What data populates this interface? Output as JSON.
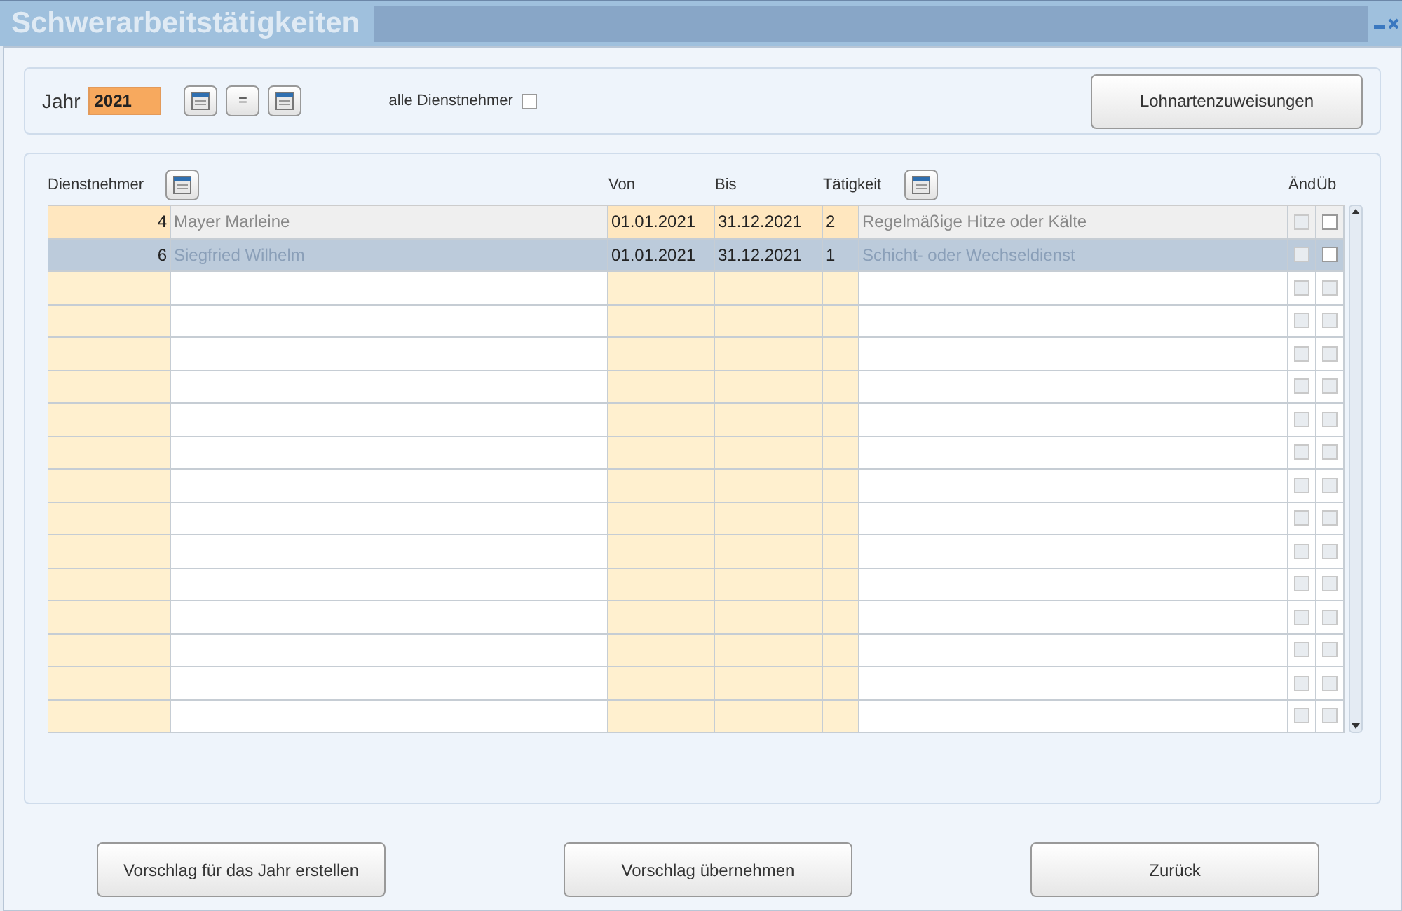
{
  "window": {
    "title": "Schwerarbeitstätigkeiten"
  },
  "filter": {
    "year_label": "Jahr",
    "year_value": "2021",
    "equals_button": "=",
    "all_label": "alle Dienstnehmer",
    "all_checked": false,
    "assign_button": "Lohnartenzuweisungen"
  },
  "table": {
    "columns": [
      {
        "label": "Dienstnehmer",
        "picker": true
      },
      {
        "label": "Von",
        "picker": false
      },
      {
        "label": "Bis",
        "picker": false
      },
      {
        "label": "Tätigkeit",
        "picker": true
      },
      {
        "label": "Änd",
        "picker": false
      },
      {
        "label": "Üb",
        "picker": false
      }
    ],
    "rows": [
      {
        "number": "4",
        "name": "Mayer Marleine",
        "from": "01.01.2021",
        "to": "31.12.2021",
        "code": "2",
        "activity": "Regelmäßige Hitze oder Kälte",
        "changed": false,
        "taken": false,
        "selected": false
      },
      {
        "number": "6",
        "name": "Siegfried Wilhelm",
        "from": "01.01.2021",
        "to": "31.12.2021",
        "code": "1",
        "activity": "Schicht- oder Wechseldienst",
        "changed": false,
        "taken": false,
        "selected": true
      },
      {
        "changed": false,
        "taken": false,
        "selected": false
      },
      {
        "changed": false,
        "taken": false,
        "selected": false
      },
      {
        "changed": false,
        "taken": false,
        "selected": false
      },
      {
        "changed": false,
        "taken": false,
        "selected": false
      },
      {
        "changed": false,
        "taken": false,
        "selected": false
      },
      {
        "changed": false,
        "taken": false,
        "selected": false
      },
      {
        "changed": false,
        "taken": false,
        "selected": false
      },
      {
        "changed": false,
        "taken": false,
        "selected": false
      },
      {
        "changed": false,
        "taken": false,
        "selected": false
      },
      {
        "changed": false,
        "taken": false,
        "selected": false
      },
      {
        "changed": false,
        "taken": false,
        "selected": false
      },
      {
        "changed": false,
        "taken": false,
        "selected": false
      },
      {
        "changed": false,
        "taken": false,
        "selected": false
      },
      {
        "changed": false,
        "taken": false,
        "selected": false
      }
    ]
  },
  "buttons": [
    "Vorschlag für das Jahr erstellen",
    "Vorschlag übernehmen",
    "Zurück"
  ]
}
